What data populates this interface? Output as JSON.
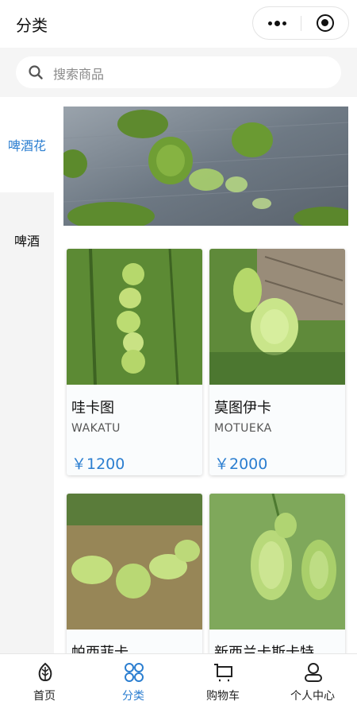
{
  "header": {
    "title": "分类",
    "more_icon": "more-dots-icon",
    "close_icon": "target-circle-icon"
  },
  "search": {
    "placeholder": "搜索商品",
    "icon": "search-icon"
  },
  "sidebar": {
    "items": [
      {
        "label": "啤酒花",
        "active": true
      },
      {
        "label": "啤酒",
        "active": false
      }
    ]
  },
  "products": [
    {
      "name": "哇卡图",
      "english": "WAKATU",
      "price": "￥1200"
    },
    {
      "name": "莫图伊卡",
      "english": "MOTUEKA",
      "price": "￥2000"
    },
    {
      "name": "帕西菲卡",
      "english": "",
      "price": ""
    },
    {
      "name": "新西兰卡斯卡特",
      "english": "",
      "price": ""
    }
  ],
  "tabbar": {
    "items": [
      {
        "label": "首页",
        "icon": "home-leaf-icon",
        "active": false
      },
      {
        "label": "分类",
        "icon": "category-icon",
        "active": true
      },
      {
        "label": "购物车",
        "icon": "cart-icon",
        "active": false
      },
      {
        "label": "个人中心",
        "icon": "user-icon",
        "active": false
      }
    ]
  },
  "colors": {
    "accent": "#2b7ed0",
    "hop_green": "#9cc74a",
    "background": "#f4f4f4"
  }
}
